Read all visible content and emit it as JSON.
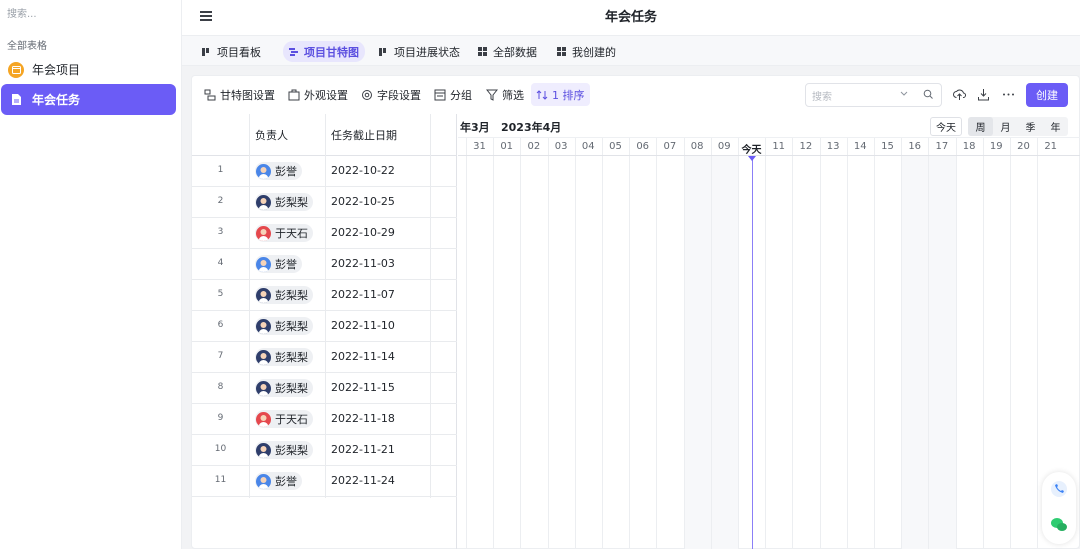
{
  "sidebar": {
    "search_placeholder": "搜索...",
    "section_label": "全部表格",
    "items": [
      {
        "label": "年会项目",
        "icon": "calendar-icon"
      },
      {
        "label": "年会任务",
        "icon": "document-icon",
        "active": true
      }
    ]
  },
  "header": {
    "title": "年会任务"
  },
  "tabs": [
    {
      "label": "项目看板",
      "icon": "kanban-icon"
    },
    {
      "label": "项目甘特图",
      "icon": "gantt-icon",
      "active": true
    },
    {
      "label": "项目进展状态",
      "icon": "kanban-icon"
    },
    {
      "label": "全部数据",
      "icon": "grid-icon"
    },
    {
      "label": "我创建的",
      "icon": "grid-icon"
    }
  ],
  "toolbar": {
    "gantt_settings": "甘特图设置",
    "appearance": "外观设置",
    "fields": "字段设置",
    "group": "分组",
    "filter": "筛选",
    "sort": "1 排序",
    "search_placeholder": "搜索",
    "create": "创建"
  },
  "table": {
    "headers": {
      "owner": "负责人",
      "due_date": "任务截止日期"
    },
    "rows": [
      {
        "num": "1",
        "owner": "彭誉",
        "avatar": "blue",
        "date": "2022-10-22"
      },
      {
        "num": "2",
        "owner": "彭梨梨",
        "avatar": "navy",
        "date": "2022-10-25"
      },
      {
        "num": "3",
        "owner": "于天石",
        "avatar": "red",
        "date": "2022-10-29"
      },
      {
        "num": "4",
        "owner": "彭誉",
        "avatar": "blue",
        "date": "2022-11-03"
      },
      {
        "num": "5",
        "owner": "彭梨梨",
        "avatar": "navy",
        "date": "2022-11-07"
      },
      {
        "num": "6",
        "owner": "彭梨梨",
        "avatar": "navy",
        "date": "2022-11-10"
      },
      {
        "num": "7",
        "owner": "彭梨梨",
        "avatar": "navy",
        "date": "2022-11-14"
      },
      {
        "num": "8",
        "owner": "彭梨梨",
        "avatar": "navy",
        "date": "2022-11-15"
      },
      {
        "num": "9",
        "owner": "于天石",
        "avatar": "red",
        "date": "2022-11-18"
      },
      {
        "num": "10",
        "owner": "彭梨梨",
        "avatar": "navy",
        "date": "2022-11-21"
      },
      {
        "num": "11",
        "owner": "彭誉",
        "avatar": "blue",
        "date": "2022-11-24"
      }
    ]
  },
  "gantt": {
    "prev_month": "年3月",
    "month": "2023年4月",
    "today_button": "今天",
    "scales": [
      "周",
      "月",
      "季",
      "年"
    ],
    "selected_scale": "周",
    "days": [
      "31",
      "01",
      "02",
      "03",
      "04",
      "05",
      "06",
      "07",
      "08",
      "09",
      "今天",
      "11",
      "12",
      "13",
      "14",
      "15",
      "16",
      "17",
      "18",
      "19",
      "20",
      "21"
    ],
    "today_label": "今天"
  },
  "colors": {
    "accent": "#6b5cf6",
    "avatar_blue": "#4a86e8",
    "avatar_navy": "#2f3e6b",
    "avatar_red": "#e5484d"
  }
}
